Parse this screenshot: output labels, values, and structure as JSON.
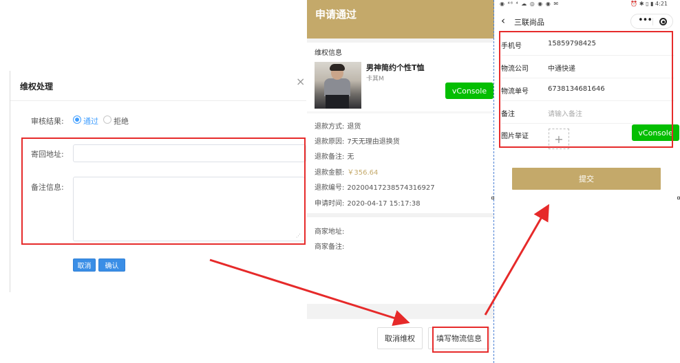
{
  "admin_dialog": {
    "title": "维权处理",
    "close_glyph": "×",
    "review_label": "审核结果:",
    "radio_options": [
      "通过",
      "拒绝"
    ],
    "selected": "通过",
    "return_address_label": "寄回地址:",
    "return_address_value": "",
    "remark_label": "备注信息:",
    "remark_value": "",
    "cancel_label": "取消",
    "confirm_label": "确认"
  },
  "refund_screen": {
    "header_title": "申请通过",
    "section_title": "维权信息",
    "product": {
      "name": "男神简约个性T恤",
      "spec": "卡其M"
    },
    "vconsole_label": "vConsole",
    "details": [
      {
        "label": "退款方式:",
        "value": "退货"
      },
      {
        "label": "退款原因:",
        "value": "7天无理由退换货"
      },
      {
        "label": "退款备注:",
        "value": "无"
      },
      {
        "label": "退款金额:",
        "value": "￥356.64"
      },
      {
        "label": "退款编号:",
        "value": "20200417238574316927"
      },
      {
        "label": "申请时间:",
        "value": "2020-04-17 15:17:38"
      }
    ],
    "merchant_address_label": "商家地址:",
    "merchant_remark_label": "商家备注:",
    "cancel_button": "取消维权",
    "logistics_button": "填写物流信息"
  },
  "logistics_screen": {
    "status_left": "◉ ⁴⁶ ⁴ ☁ ◎ ◉ ◉ ✉",
    "status_right": "⏰ ✱ ▯ ▮ 4:21",
    "nav_title": "三联尚品",
    "back_glyph": "‹",
    "capsule_dots": "•••",
    "fields": [
      {
        "label": "手机号",
        "value": "15859798425",
        "placeholder": false
      },
      {
        "label": "物流公司",
        "value": "中通快递",
        "placeholder": false
      },
      {
        "label": "物流单号",
        "value": "6738134681646",
        "placeholder": false
      },
      {
        "label": "备注",
        "value": "请输入备注",
        "placeholder": true
      }
    ],
    "photo_label": "图片举证",
    "upload_glyph": "+",
    "vconsole_label": "vConsole",
    "submit_label": "提交"
  },
  "colors": {
    "gold": "#c4a96a",
    "highlight_red": "#e62a2a",
    "vconsole_green": "#04be02",
    "primary_blue": "#3a8ee6"
  }
}
